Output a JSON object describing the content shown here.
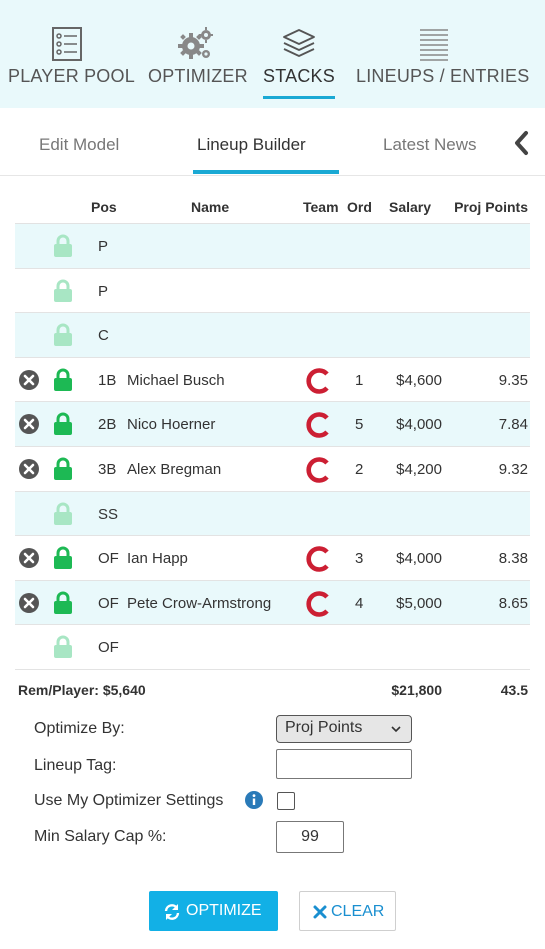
{
  "nav": {
    "items": [
      {
        "label": "PLAYER POOL",
        "icon": "player-list-icon"
      },
      {
        "label": "OPTIMIZER",
        "icon": "gears-icon"
      },
      {
        "label": "STACKS",
        "icon": "stack-layers-icon"
      },
      {
        "label": "LINEUPS / ENTRIES",
        "icon": "lines-list-icon"
      }
    ],
    "active": "STACKS"
  },
  "subtabs": {
    "items": [
      "Edit Model",
      "Lineup Builder",
      "Latest News"
    ],
    "active": "Lineup Builder"
  },
  "table": {
    "headers": {
      "pos": "Pos",
      "name": "Name",
      "team": "Team",
      "ord": "Ord",
      "salary": "Salary",
      "proj": "Proj Points"
    },
    "rows": [
      {
        "pos": "P",
        "name": "",
        "ord": "",
        "salary": "",
        "proj": "",
        "filled": false
      },
      {
        "pos": "P",
        "name": "",
        "ord": "",
        "salary": "",
        "proj": "",
        "filled": false
      },
      {
        "pos": "C",
        "name": "",
        "ord": "",
        "salary": "",
        "proj": "",
        "filled": false
      },
      {
        "pos": "1B",
        "name": "Michael Busch",
        "ord": "1",
        "salary": "$4,600",
        "proj": "9.35",
        "filled": true
      },
      {
        "pos": "2B",
        "name": "Nico Hoerner",
        "ord": "5",
        "salary": "$4,000",
        "proj": "7.84",
        "filled": true
      },
      {
        "pos": "3B",
        "name": "Alex Bregman",
        "ord": "2",
        "salary": "$4,200",
        "proj": "9.32",
        "filled": true
      },
      {
        "pos": "SS",
        "name": "",
        "ord": "",
        "salary": "",
        "proj": "",
        "filled": false
      },
      {
        "pos": "OF",
        "name": "Ian Happ",
        "ord": "3",
        "salary": "$4,000",
        "proj": "8.38",
        "filled": true
      },
      {
        "pos": "OF",
        "name": "Pete Crow-Armstrong",
        "ord": "4",
        "salary": "$5,000",
        "proj": "8.65",
        "filled": true
      },
      {
        "pos": "OF",
        "name": "",
        "ord": "",
        "salary": "",
        "proj": "",
        "filled": false
      }
    ],
    "totals": {
      "rem_player": "Rem/Player: $5,640",
      "salary": "$21,800",
      "proj": "43.5"
    }
  },
  "form": {
    "optimize_by_label": "Optimize By:",
    "optimize_by_value": "Proj Points",
    "lineup_tag_label": "Lineup Tag:",
    "lineup_tag_value": "",
    "use_settings_label": "Use My Optimizer Settings",
    "use_settings_checked": false,
    "min_salary_label": "Min Salary Cap %:",
    "min_salary_value": "99"
  },
  "buttons": {
    "optimize": "OPTIMIZE",
    "clear": "CLEAR"
  },
  "colors": {
    "accent": "#1aa9d4",
    "lock_active": "#1db954",
    "lock_inactive": "#a8e6c4",
    "team": "#cc1f33",
    "row_alt": "#e9f9fb"
  }
}
